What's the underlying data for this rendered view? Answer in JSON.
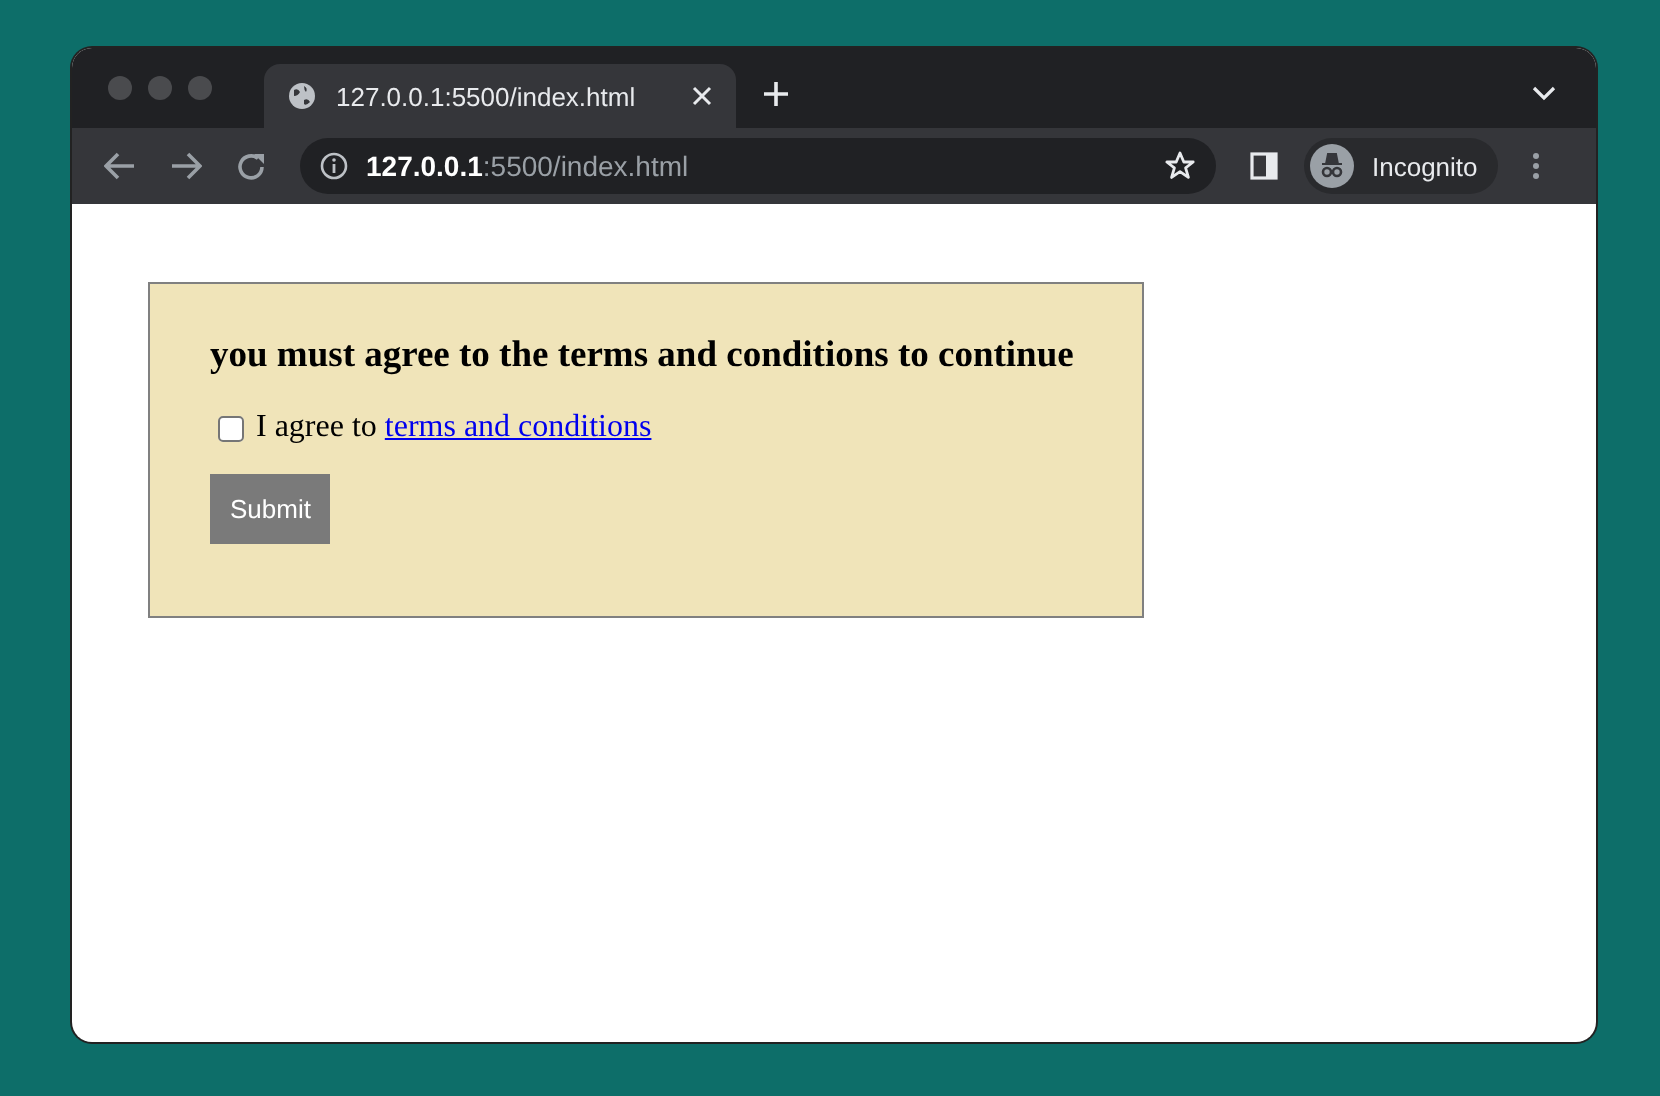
{
  "browser": {
    "tab": {
      "title": "127.0.0.1:5500/index.html",
      "selected": true
    },
    "address": {
      "host": "127.0.0.1",
      "path": ":5500/index.html"
    },
    "profile": "Incognito"
  },
  "form": {
    "heading": "you must agree to the terms and conditions to continue",
    "agree": {
      "label": "I agree to",
      "link": "terms and conditions",
      "checked": false
    },
    "submit": {
      "label": "Submit",
      "disabled": true
    }
  }
}
